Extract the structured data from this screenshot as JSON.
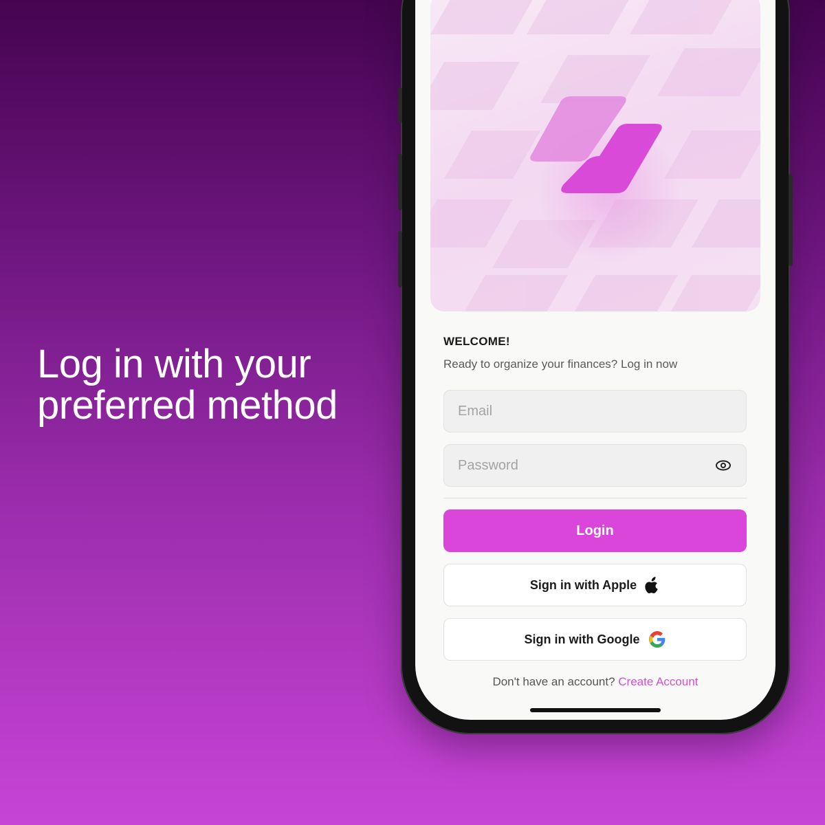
{
  "headline": {
    "line1": "Log in with your",
    "line2": "preferred method"
  },
  "app": {
    "welcome_title": "WELCOME!",
    "welcome_subtitle": "Ready to organize your finances? Log in now",
    "email": {
      "value": "",
      "placeholder": "Email"
    },
    "password": {
      "value": "",
      "placeholder": "Password",
      "toggle_icon": "eye-icon"
    },
    "login_label": "Login",
    "apple_label": "Sign in with Apple",
    "apple_icon": "apple-icon",
    "google_label": "Sign in with Google",
    "google_icon": "google-icon",
    "signup_prompt": "Don't have an account?",
    "signup_link": "Create Account"
  },
  "colors": {
    "accent": "#d946d9",
    "bg_top": "#450450",
    "bg_bottom": "#c744d6",
    "logo_light": "#e38de0",
    "logo_dark": "#d94ad9"
  }
}
